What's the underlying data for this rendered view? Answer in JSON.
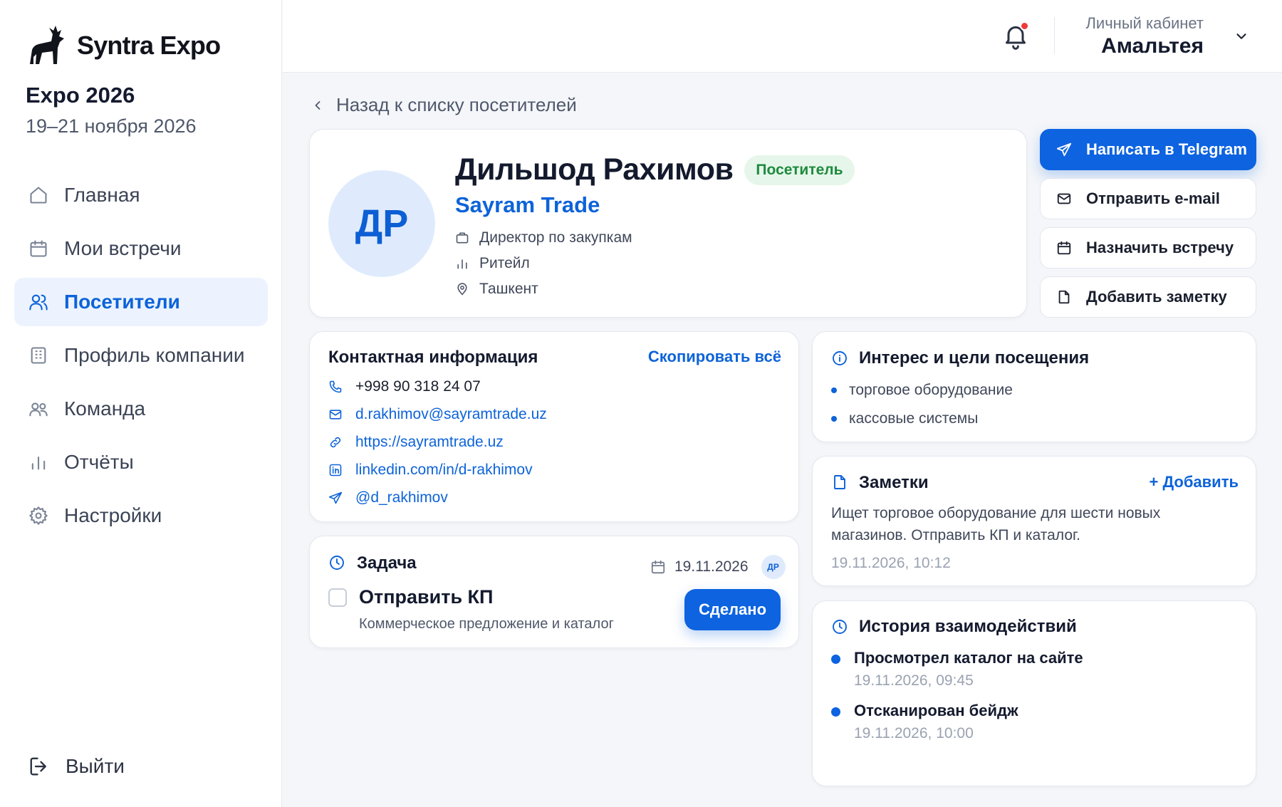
{
  "brand": {
    "name": "Syntra Expo"
  },
  "event": {
    "name": "Expo 2026",
    "dates": "19–21 ноября 2026"
  },
  "sidebar": {
    "items": [
      {
        "label": "Главная",
        "icon": "home-icon",
        "active": false
      },
      {
        "label": "Мои встречи",
        "icon": "calendar-icon",
        "active": false
      },
      {
        "label": "Посетители",
        "icon": "users-icon",
        "active": true
      },
      {
        "label": "Профиль компании",
        "icon": "building-icon",
        "active": false
      },
      {
        "label": "Команда",
        "icon": "team-icon",
        "active": false
      },
      {
        "label": "Отчёты",
        "icon": "bar-chart-icon",
        "active": false
      },
      {
        "label": "Настройки",
        "icon": "gear-icon",
        "active": false
      }
    ],
    "logout": "Выйти"
  },
  "header": {
    "account_label": "Личный кабинет",
    "account_name": "Амальтея",
    "has_notification": true
  },
  "back_link": "Назад к списку посетителей",
  "profile": {
    "initials": "ДР",
    "name": "Дильшод Рахимов",
    "badge": "Посетитель",
    "company": "Sayram Trade",
    "position": "Директор по закупкам",
    "industry": "Ритейл",
    "city": "Ташкент"
  },
  "actions": {
    "telegram": "Написать в Telegram",
    "email": "Отправить e-mail",
    "meeting": "Назначить встречу",
    "note": "Добавить заметку"
  },
  "contacts": {
    "title": "Контактная информация",
    "copy_all": "Скопировать всё",
    "phone": "+998 90 318 24 07",
    "email": "d.rakhimov@sayramtrade.uz",
    "website": "https://sayramtrade.uz",
    "linkedin": "linkedin.com/in/d-rakhimov",
    "telegram": "@d_rakhimov"
  },
  "task": {
    "title": "Задача",
    "date": "19.11.2026",
    "assignee_initials": "ДР",
    "name": "Отправить КП",
    "description": "Коммерческое предложение и каталог",
    "done_label": "Сделано",
    "checked": false
  },
  "interests": {
    "title": "Интерес и цели посещения",
    "items": [
      "торговое оборудование",
      "кассовые системы"
    ]
  },
  "notes": {
    "title": "Заметки",
    "add_label": "+ Добавить",
    "text": "Ищет торговое оборудование для шести новых магазинов. Отправить КП и каталог.",
    "time": "19.11.2026, 10:12"
  },
  "history": {
    "title": "История взаимодействий",
    "items": [
      {
        "title": "Просмотрел каталог на сайте",
        "time": "19.11.2026, 09:45"
      },
      {
        "title": "Отсканирован бейдж",
        "time": "19.11.2026, 10:00"
      }
    ]
  },
  "colors": {
    "accent": "#0d63e0",
    "badge_bg": "#e6f6ea",
    "badge_text": "#1e8a3e",
    "notification": "#ef3b3b"
  }
}
